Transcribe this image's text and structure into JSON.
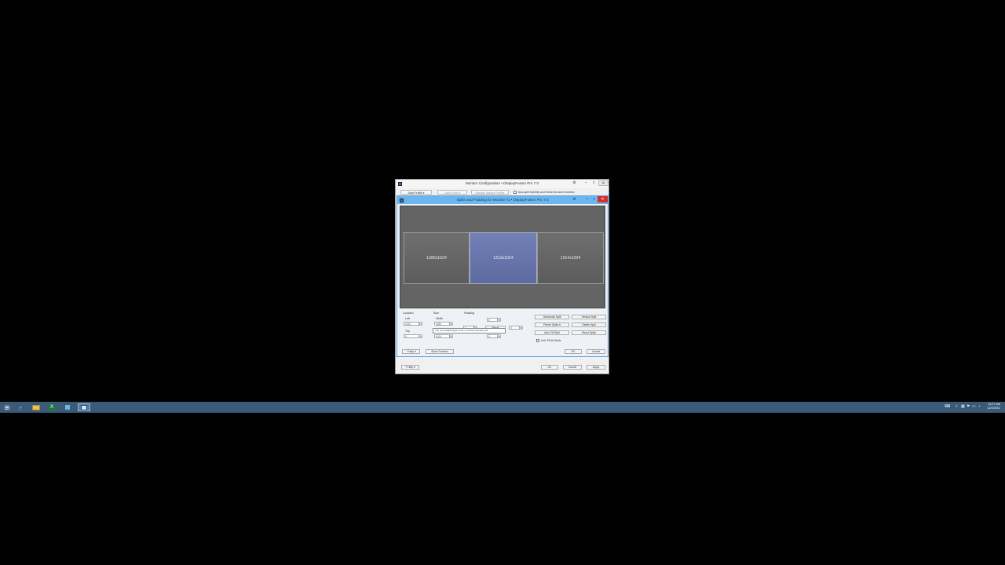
{
  "outer_window": {
    "title": "Monitor Configuration • DisplayFusion Pro 7.0",
    "toolbar": {
      "save_profile": "Save Profile",
      "load_profile": "Load Profile",
      "manage_profiles": "Manage Monitor Profiles",
      "auto_split_label": "Auto-split Eyefinity and nVidia Surround monitors"
    },
    "footer": {
      "help": "Help",
      "ok": "OK",
      "cancel": "Cancel",
      "apply": "Apply"
    }
  },
  "inner_dialog": {
    "title": "Splits and Padding for Monitor #1 • DisplayFusion Pro 7.0",
    "splits": [
      {
        "label": "1280x1024",
        "selected": false
      },
      {
        "label": "1313x1024",
        "selected": true
      },
      {
        "label": "1314x1024",
        "selected": false
      }
    ],
    "location": {
      "group": "Location",
      "left_label": "Left",
      "left_value": "1313",
      "top_label": "Top",
      "top_value": "0"
    },
    "size": {
      "group": "Size",
      "width_label": "Width",
      "width_value": "1280",
      "height_value": "1024"
    },
    "padding": {
      "group": "Padding",
      "top": "0",
      "left": "0",
      "right": "0",
      "bottom": "0",
      "reset": "Reset"
    },
    "tooltip": "The new width/height of the currently selected split",
    "actions": {
      "horizontal_split": "Horizontal Split",
      "vertical_split": "Vertical Split",
      "preset_splits": "Preset Splits",
      "delete_split": "Delete Split",
      "auto_fill_split": "Auto Fill Split",
      "reset_splits": "Reset Splits",
      "auto_fill_all": "Auto Fill All Splits"
    },
    "footer": {
      "help": "Help",
      "show_preview": "Show Preview",
      "ok": "OK",
      "cancel": "Cancel"
    }
  },
  "taskbar": {
    "apps": [
      "start-icon",
      "ie-icon",
      "explorer-icon",
      "excel-icon",
      "app-icon",
      "displayfusion-icon"
    ],
    "clock_time": "11:27 AM",
    "clock_date": "12/3/2014"
  },
  "colors": {
    "accent": "#6cb6f0",
    "selected_split": "#6574a8",
    "taskbar": "#3a5a78",
    "close": "#d9302b"
  }
}
